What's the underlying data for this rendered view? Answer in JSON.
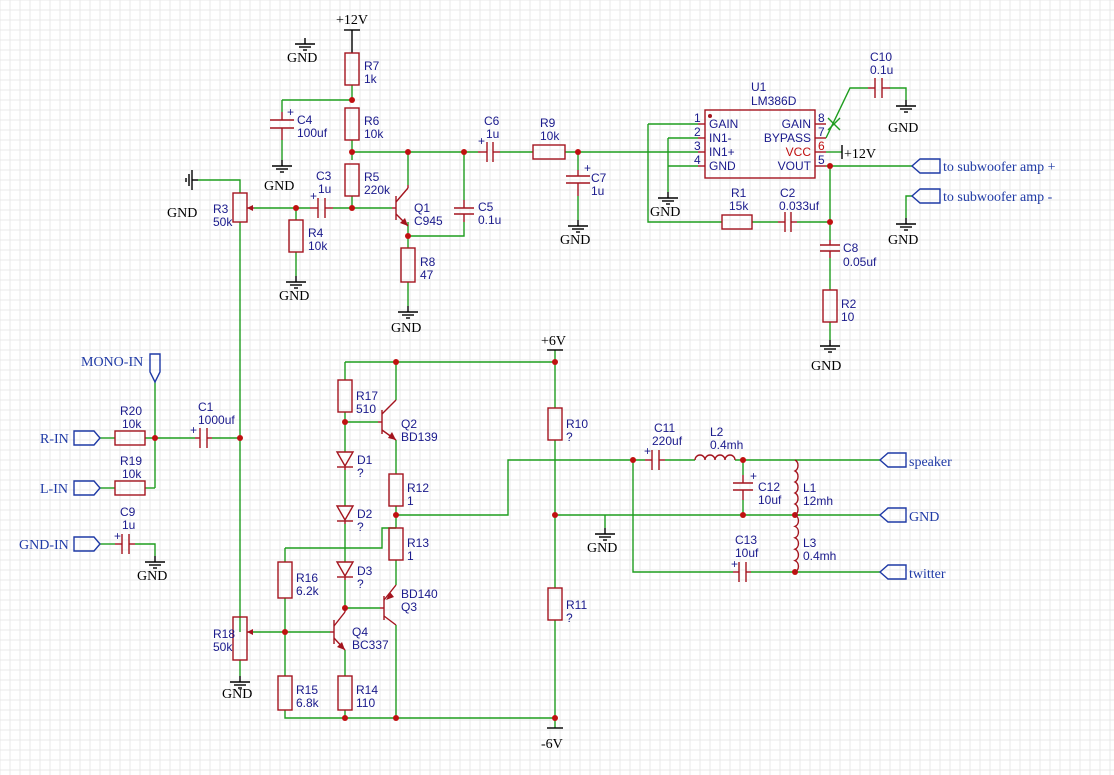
{
  "colors": {
    "wire": "#1f9d1f",
    "part": "#a4141e",
    "label": "#1a1a8c",
    "port": "#1f3aa6",
    "junction": "#c01010"
  },
  "nets": {
    "v12_top": "+12V",
    "v12_u1": "+12V",
    "v6_pos": "+6V",
    "v6_neg": "-6V",
    "gnd": "GND"
  },
  "ports": {
    "mono_in": "MONO-IN",
    "r_in": "R-IN",
    "l_in": "L-IN",
    "gnd_in": "GND-IN",
    "sub_pos": "to subwoofer amp +",
    "sub_neg": "to subwoofer amp -",
    "speaker": "speaker",
    "gnd_out": "GND",
    "twitter": "twitter"
  },
  "components": {
    "R7": {
      "ref": "R7",
      "val": "1k"
    },
    "R6": {
      "ref": "R6",
      "val": "10k"
    },
    "R5": {
      "ref": "R5",
      "val": "220k"
    },
    "R4": {
      "ref": "R4",
      "val": "10k"
    },
    "R8": {
      "ref": "R8",
      "val": "47"
    },
    "R3": {
      "ref": "R3",
      "val": "50k"
    },
    "C4": {
      "ref": "C4",
      "val": "100uf"
    },
    "C3": {
      "ref": "C3",
      "val": "1u"
    },
    "Q1": {
      "ref": "Q1",
      "val": "C945"
    },
    "C5": {
      "ref": "C5",
      "val": "0.1u"
    },
    "C6": {
      "ref": "C6",
      "val": "1u"
    },
    "R9": {
      "ref": "R9",
      "val": "10k"
    },
    "C7": {
      "ref": "C7",
      "val": "1u"
    },
    "U1": {
      "ref": "U1",
      "val": "LM386D"
    },
    "C10": {
      "ref": "C10",
      "val": "0.1u"
    },
    "R1": {
      "ref": "R1",
      "val": "15k"
    },
    "C2": {
      "ref": "C2",
      "val": "0.033uf"
    },
    "C8": {
      "ref": "C8",
      "val": "0.05uf"
    },
    "R2": {
      "ref": "R2",
      "val": "10"
    },
    "C1": {
      "ref": "C1",
      "val": "1000uf"
    },
    "R20": {
      "ref": "R20",
      "val": "10k"
    },
    "R19": {
      "ref": "R19",
      "val": "10k"
    },
    "C9": {
      "ref": "C9",
      "val": "1u"
    },
    "R17": {
      "ref": "R17",
      "val": "510"
    },
    "Q2": {
      "ref": "Q2",
      "val": "BD139"
    },
    "D1": {
      "ref": "D1",
      "val": "?"
    },
    "R12": {
      "ref": "R12",
      "val": "1"
    },
    "D2": {
      "ref": "D2",
      "val": "?"
    },
    "R13": {
      "ref": "R13",
      "val": "1"
    },
    "D3": {
      "ref": "D3",
      "val": "?"
    },
    "R16": {
      "ref": "R16",
      "val": "6.2k"
    },
    "Q3": {
      "ref": "Q3",
      "val": "BD140"
    },
    "Q4": {
      "ref": "Q4",
      "val": "BC337"
    },
    "R18": {
      "ref": "R18",
      "val": "50k"
    },
    "R15": {
      "ref": "R15",
      "val": "6.8k"
    },
    "R14": {
      "ref": "R14",
      "val": "110"
    },
    "R10": {
      "ref": "R10",
      "val": "?"
    },
    "R11": {
      "ref": "R11",
      "val": "?"
    },
    "C11": {
      "ref": "C11",
      "val": "220uf"
    },
    "L2": {
      "ref": "L2",
      "val": "0.4mh"
    },
    "C12": {
      "ref": "C12",
      "val": "10uf"
    },
    "L1": {
      "ref": "L1",
      "val": "12mh"
    },
    "C13": {
      "ref": "C13",
      "val": "10uf"
    },
    "L3": {
      "ref": "L3",
      "val": "0.4mh"
    }
  },
  "u1_pins": {
    "p1": {
      "num": "1",
      "name": "GAIN"
    },
    "p2": {
      "num": "2",
      "name": "IN1-"
    },
    "p3": {
      "num": "3",
      "name": "IN1+"
    },
    "p4": {
      "num": "4",
      "name": "GND"
    },
    "p8": {
      "num": "8",
      "name": "GAIN"
    },
    "p7": {
      "num": "7",
      "name": "BYPASS"
    },
    "p6": {
      "num": "6",
      "name": "VCC"
    },
    "p5": {
      "num": "5",
      "name": "VOUT"
    }
  }
}
